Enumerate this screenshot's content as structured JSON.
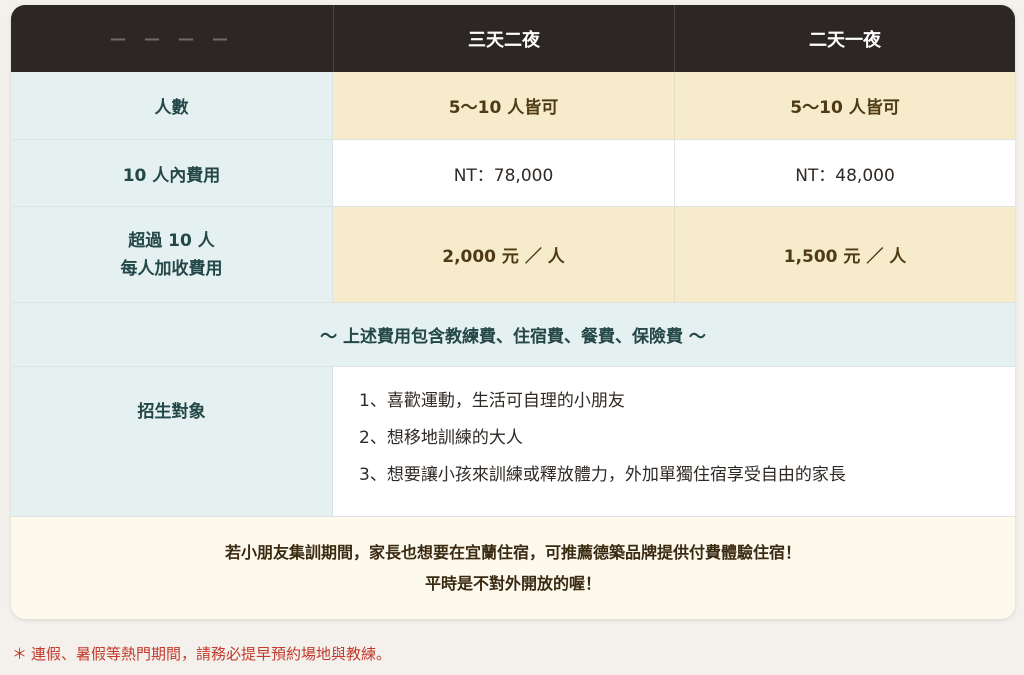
{
  "header": {
    "placeholder_dashes": [
      "—",
      "—",
      "—",
      "—"
    ],
    "col_3d2n": "三天二夜",
    "col_2d1n": "二天一夜"
  },
  "rows": {
    "people": {
      "label": "人數",
      "val_3d2n": "5～10 人皆可",
      "val_2d1n": "5～10 人皆可"
    },
    "fee_within_10": {
      "label": "10 人內費用",
      "val_3d2n": "NT：78,000",
      "val_2d1n": "NT：48,000"
    },
    "extra_fee": {
      "label_line1": "超過 10 人",
      "label_line2": "每人加收費用",
      "val_3d2n": "2,000 元 ／ 人",
      "val_2d1n": "1,500 元 ／ 人"
    }
  },
  "includes_note": "～ 上述費用包含教練費、住宿費、餐費、保險費 ～",
  "target": {
    "label": "招生對象",
    "items": [
      "1、喜歡運動，生活可自理的小朋友",
      "2、想移地訓練的大人",
      "3、想要讓小孩來訓練或釋放體力，外加單獨住宿享受自由的家長"
    ]
  },
  "footer": {
    "line1": "若小朋友集訓期間，家長也想要在宜蘭住宿，可推薦德築品牌提供付費體驗住宿！",
    "line2": "平時是不對外開放的喔！"
  },
  "footnote": {
    "star": "＊",
    "text": "連假、暑假等熱門期間，請務必提早預約場地與教練。"
  },
  "colors": {
    "header_bg": "#2c2724",
    "label_bg": "#e5f0f1",
    "highlight_bg": "#f6eccb",
    "footer_bg": "#fdf9ec",
    "footnote_text": "#c23a2d"
  }
}
